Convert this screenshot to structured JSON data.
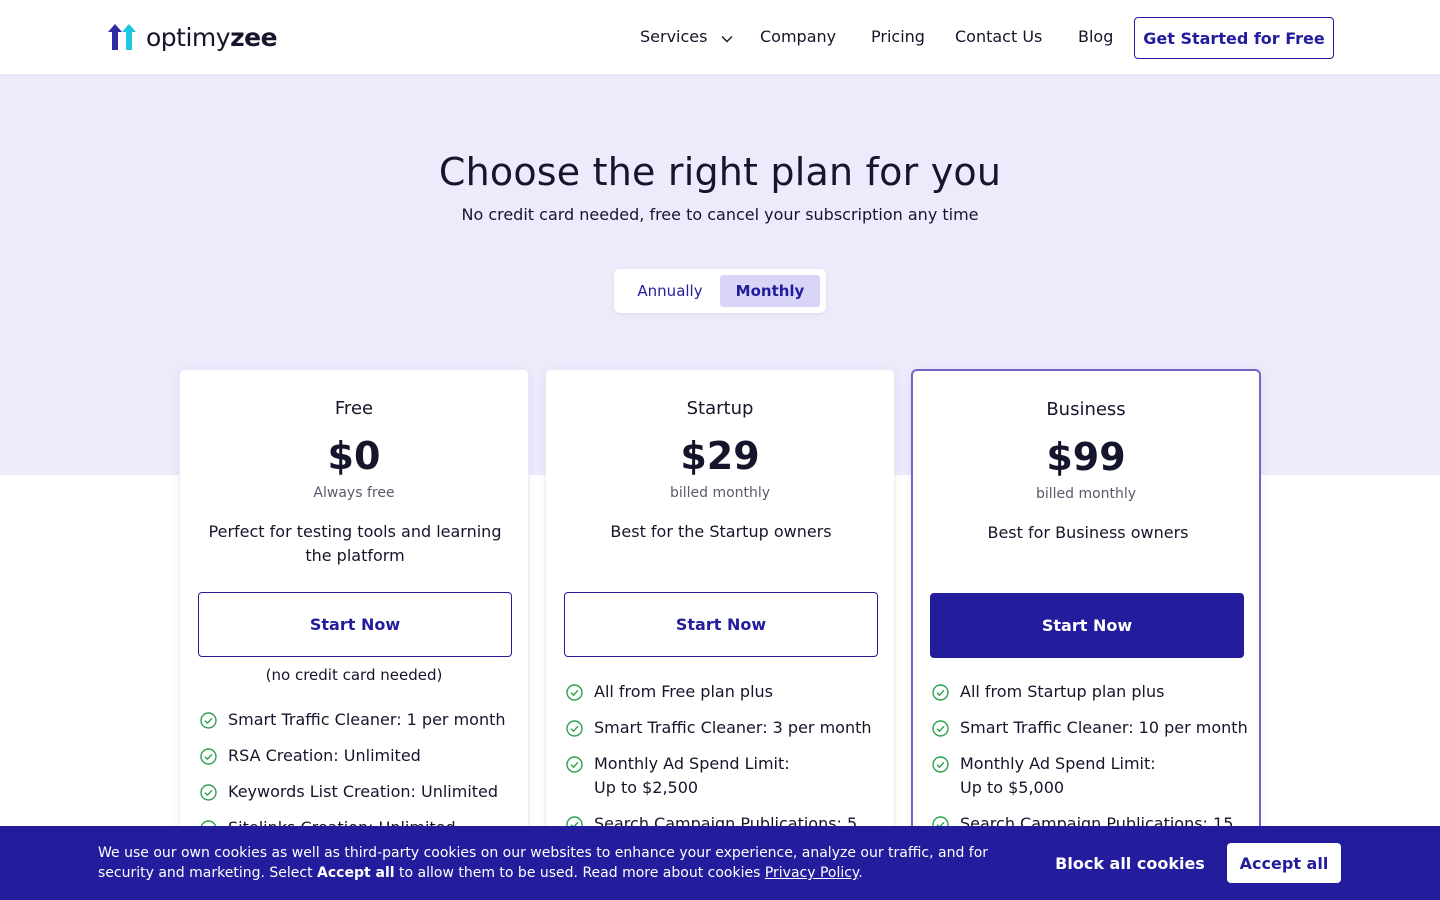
{
  "brand": {
    "logo_light": "optimy",
    "logo_bold": "zee",
    "colors": {
      "primary": "#231c9c",
      "hero_bg": "#eceafb",
      "logo_blue": "#2f2aa6",
      "logo_teal": "#1ec6e0",
      "check_green": "#2ea04f"
    }
  },
  "nav": {
    "items": [
      {
        "label": "Services",
        "has_dropdown": true
      },
      {
        "label": "Company"
      },
      {
        "label": "Pricing"
      },
      {
        "label": "Contact Us"
      },
      {
        "label": "Blog"
      }
    ],
    "cta": "Get Started for Free"
  },
  "hero": {
    "title": "Choose the right plan for you",
    "subtitle": "No credit card needed, free to cancel your subscription any time",
    "billing_toggle": {
      "options": [
        "Annually",
        "Monthly"
      ],
      "selected": "Monthly"
    }
  },
  "plans": [
    {
      "name": "Free",
      "price": "$0",
      "period": "Always free",
      "description": "Perfect for testing tools and learning the platform",
      "button": "Start Now",
      "note": "(no credit card needed)",
      "features": [
        "Smart Traffic Cleaner: 1 per month",
        "RSA Creation: Unlimited",
        "Keywords List Creation: Unlimited",
        "Sitelinks Creation: Unlimited"
      ]
    },
    {
      "name": "Startup",
      "price": "$29",
      "period": "billed monthly",
      "description": "Best for the Startup owners",
      "button": "Start Now",
      "features": [
        "All from Free plan plus",
        "Smart Traffic Cleaner: 3 per month",
        "Monthly Ad Spend Limit: Up to $2,500",
        "Search Campaign Publications: 5"
      ]
    },
    {
      "name": "Business",
      "price": "$99",
      "period": "billed monthly",
      "description": "Best for Business owners",
      "button": "Start Now",
      "featured": true,
      "features": [
        "All from Startup plan plus",
        "Smart Traffic Cleaner: 10 per month",
        "Monthly Ad Spend Limit: Up to $5,000",
        "Search Campaign Publications: 15"
      ]
    }
  ],
  "cookie": {
    "text_1": "We use our own cookies as well as third-party cookies on our websites to enhance your experience, analyze our traffic, and for security and marketing. Select ",
    "text_bold": "Accept all",
    "text_2": " to allow them to be used. Read more about cookies ",
    "link": "Privacy Policy",
    "text_3": ".",
    "block_label": "Block all cookies",
    "accept_label": "Accept all"
  }
}
